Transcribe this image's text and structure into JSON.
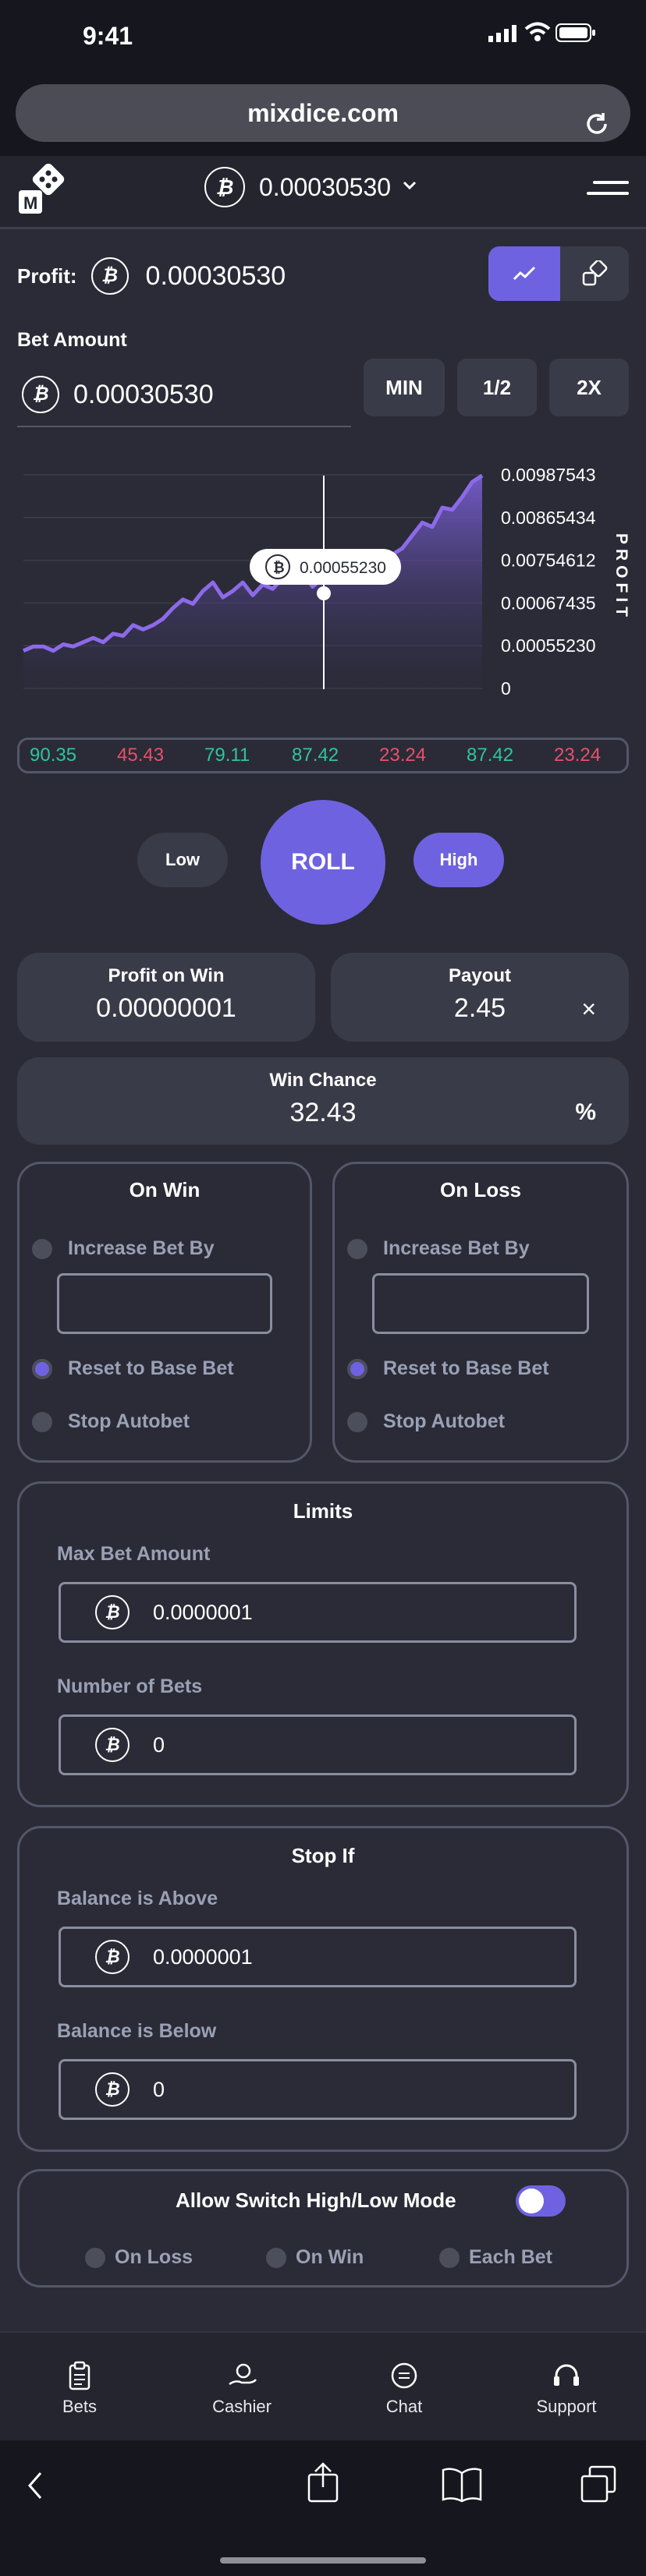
{
  "status": {
    "time": "9:41"
  },
  "browser": {
    "url": "mixdice.com"
  },
  "header": {
    "logo_letter": "M",
    "balance": "0.00030530"
  },
  "profit": {
    "label": "Profit:",
    "value": "0.00030530"
  },
  "bet": {
    "label": "Bet Amount",
    "value": "0.00030530",
    "min": "MIN",
    "half": "1/2",
    "double": "2X"
  },
  "chart_data": {
    "type": "area",
    "ylabel": "PROFIT",
    "y_ticks": [
      "0.00987543",
      "0.00865434",
      "0.00754612",
      "0.00067435",
      "0.00055230",
      "0"
    ],
    "tooltip": "0.00055230",
    "values": [
      0.18,
      0.2,
      0.2,
      0.18,
      0.21,
      0.2,
      0.22,
      0.24,
      0.22,
      0.26,
      0.25,
      0.3,
      0.28,
      0.3,
      0.33,
      0.38,
      0.42,
      0.4,
      0.46,
      0.5,
      0.43,
      0.46,
      0.5,
      0.44,
      0.49,
      0.47,
      0.52,
      0.5,
      0.55,
      0.48,
      0.52,
      0.5,
      0.53,
      0.5,
      0.52,
      0.55,
      0.6,
      0.63,
      0.66,
      0.72,
      0.78,
      0.76,
      0.85,
      0.84,
      0.9,
      0.97,
      1.0
    ]
  },
  "history": [
    {
      "v": "90.35",
      "c": "#2ec4a0"
    },
    {
      "v": "45.43",
      "c": "#e8506b"
    },
    {
      "v": "79.11",
      "c": "#2ec4a0"
    },
    {
      "v": "87.42",
      "c": "#2ec4a0"
    },
    {
      "v": "23.24",
      "c": "#e8506b"
    },
    {
      "v": "87.42",
      "c": "#2ec4a0"
    },
    {
      "v": "23.24",
      "c": "#e8506b"
    }
  ],
  "roll": {
    "low": "Low",
    "roll": "ROLL",
    "high": "High"
  },
  "stats": {
    "profit_on_win_label": "Profit on Win",
    "profit_on_win": "0.00000001",
    "payout_label": "Payout",
    "payout": "2.45",
    "payout_suffix": "×",
    "win_chance_label": "Win Chance",
    "win_chance": "32.43",
    "win_chance_suffix": "%"
  },
  "on_win": {
    "title": "On Win",
    "increase": "Increase Bet By",
    "reset": "Reset to Base Bet",
    "stop": "Stop Autobet"
  },
  "on_loss": {
    "title": "On Loss",
    "increase": "Increase Bet By",
    "reset": "Reset to Base Bet",
    "stop": "Stop Autobet"
  },
  "limits": {
    "title": "Limits",
    "max_label": "Max Bet Amount",
    "max_value": "0.0000001",
    "num_label": "Number of Bets",
    "num_value": "0"
  },
  "stop_if": {
    "title": "Stop If",
    "above_label": "Balance is Above",
    "above_value": "0.0000001",
    "below_label": "Balance is Below",
    "below_value": "0"
  },
  "switch": {
    "label": "Allow Switch High/Low Mode",
    "on_loss": "On Loss",
    "on_win": "On Win",
    "each_bet": "Each Bet"
  },
  "tabs": {
    "bets": "Bets",
    "cashier": "Cashier",
    "chat": "Chat",
    "support": "Support"
  },
  "colors": {
    "accent": "#6f62e0",
    "win": "#2ec4a0",
    "loss": "#e8506b"
  }
}
